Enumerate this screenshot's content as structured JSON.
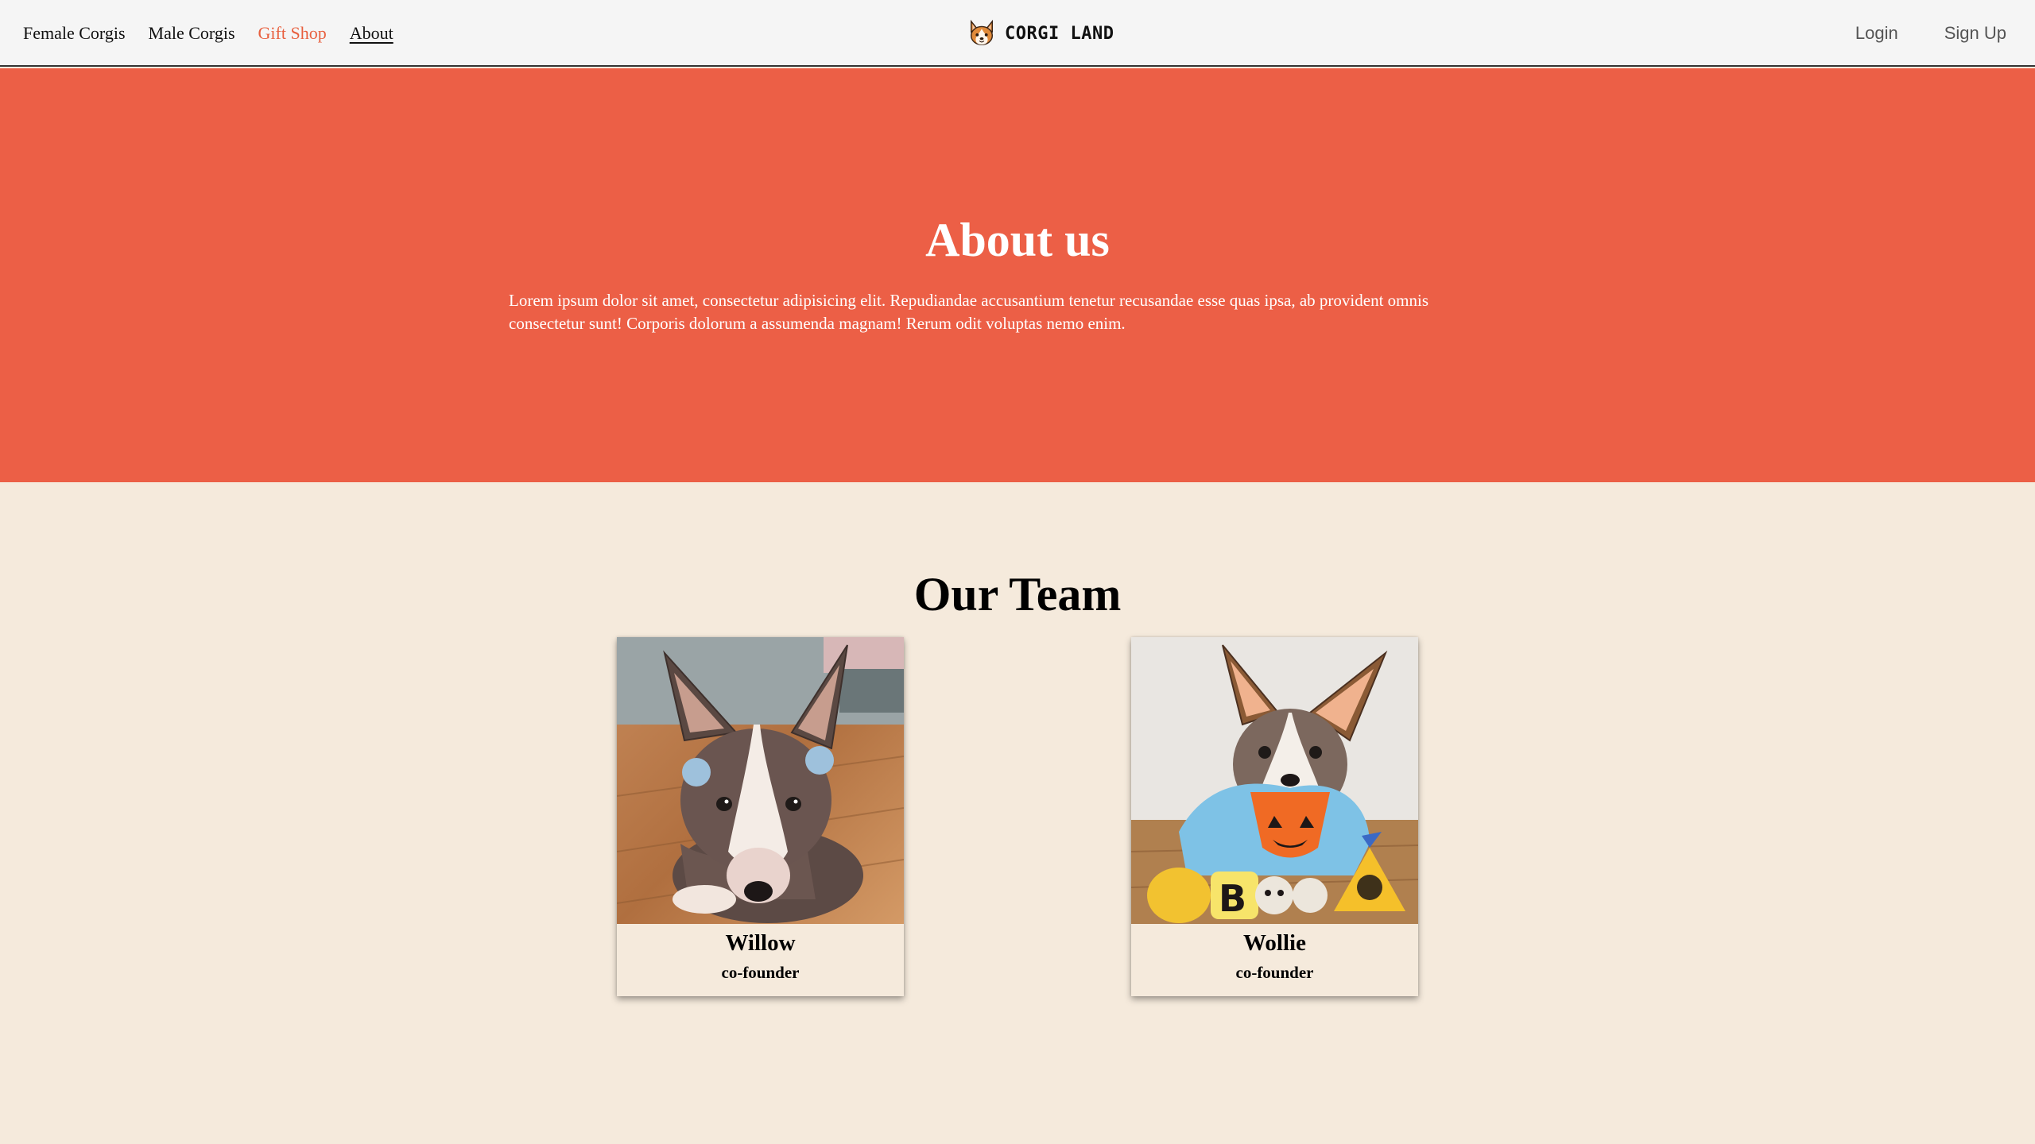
{
  "nav": {
    "links": [
      {
        "label": "Female Corgis"
      },
      {
        "label": "Male Corgis"
      },
      {
        "label": "Gift Shop"
      },
      {
        "label": "About"
      }
    ],
    "brand": {
      "text": "CORGI LAND",
      "icon": "corgi-face-icon"
    },
    "auth": {
      "login": "Login",
      "signup": "Sign Up"
    }
  },
  "hero": {
    "title": "About us",
    "body": "Lorem ipsum dolor sit amet, consectetur adipisicing elit. Repudiandae accusantium tenetur recusandae esse quas ipsa, ab provident omnis consectetur sunt! Corporis dolorum a assumenda magnam! Rerum odit voluptas nemo enim."
  },
  "team": {
    "title": "Our Team",
    "members": [
      {
        "name": "Willow",
        "role": "co-founder"
      },
      {
        "name": "Wollie",
        "role": "co-founder"
      }
    ]
  },
  "colors": {
    "accent": "#ec5f46",
    "active_link": "#e8603f",
    "page_bg": "#f5eadc",
    "nav_bg": "#f5f5f5"
  }
}
